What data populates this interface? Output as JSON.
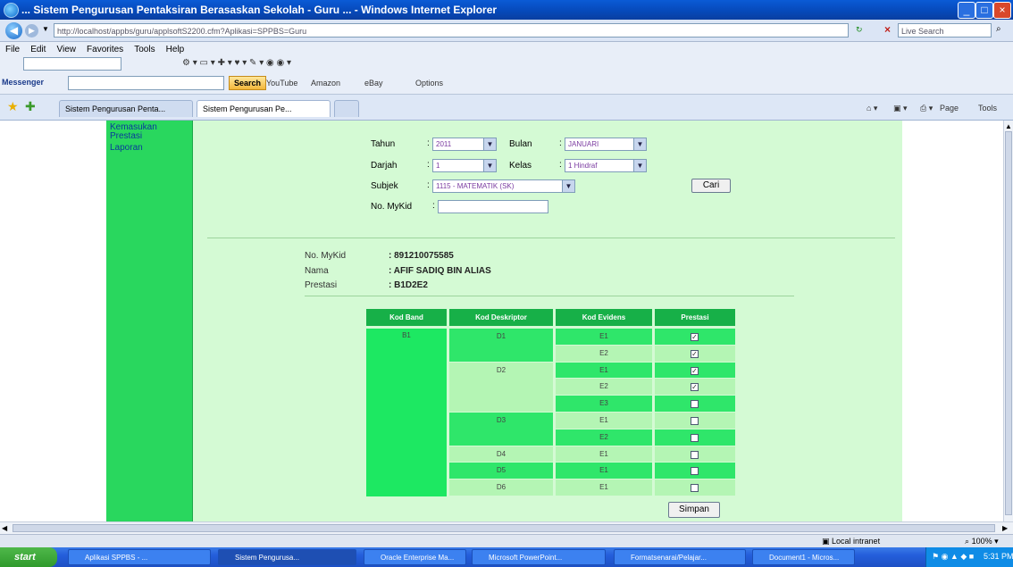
{
  "window": {
    "title": "... Sistem Pengurusan Pentaksiran Berasaskan Sekolah - Guru ... - Windows Internet Explorer"
  },
  "address": {
    "url": "http://localhost/appbs/guru/applsoftS2200.cfm?Aplikasi=SPPBS=Guru",
    "search_placeholder": "Live Search"
  },
  "menu": [
    "File",
    "Edit",
    "View",
    "Favorites",
    "Tools",
    "Help"
  ],
  "toolbar": {
    "search_label": "Search",
    "links": [
      "YouTube",
      "Amazon",
      "eBay"
    ],
    "options_label": "Options"
  },
  "tabs": [
    {
      "label": "Sistem Pengurusan Penta...",
      "active": false
    },
    {
      "label": "Sistem Pengurusan Pe...",
      "active": true
    }
  ],
  "page_tools": {
    "page_label": "Page",
    "tools_label": "Tools"
  },
  "sidebar": {
    "items": [
      "Kemasukan Prestasi",
      "Laporan"
    ]
  },
  "filters": {
    "tahun_label": "Tahun",
    "tahun_value": "2011",
    "bulan_label": "Bulan",
    "bulan_value": "JANUARI",
    "darjah_label": "Darjah",
    "darjah_value": "1",
    "kelas_label": "Kelas",
    "kelas_value": "1 Hindraf",
    "subjek_label": "Subjek",
    "subjek_value": "1115 - MATEMATIK (SK)",
    "mykid_label": "No. MyKid",
    "mykid_value": "",
    "cari_label": "Cari"
  },
  "student": {
    "mykid_label": "No. MyKid",
    "mykid_value": ": 891210075585",
    "nama_label": "Nama",
    "nama_value": ": AFIF SADIQ BIN ALIAS",
    "prestasi_label": "Prestasi",
    "prestasi_value": ": B1D2E2"
  },
  "table": {
    "headers": [
      "Kod Band",
      "Kod Deskriptor",
      "Kod Evidens",
      "Prestasi"
    ],
    "band": "B1",
    "rows": [
      {
        "deskriptor": "D1",
        "evidens": "E1",
        "checked": true
      },
      {
        "deskriptor": "",
        "evidens": "E2",
        "checked": true
      },
      {
        "deskriptor": "D2",
        "evidens": "E1",
        "checked": true
      },
      {
        "deskriptor": "",
        "evidens": "E2",
        "checked": true
      },
      {
        "deskriptor": "",
        "evidens": "E3",
        "checked": false
      },
      {
        "deskriptor": "D3",
        "evidens": "E1",
        "checked": false
      },
      {
        "deskriptor": "",
        "evidens": "E2",
        "checked": false
      },
      {
        "deskriptor": "D4",
        "evidens": "E1",
        "checked": false
      },
      {
        "deskriptor": "D5",
        "evidens": "E1",
        "checked": false
      },
      {
        "deskriptor": "D6",
        "evidens": "E1",
        "checked": false
      }
    ],
    "simpan_label": "Simpan"
  },
  "status": {
    "zone": "Local intranet",
    "zoom": "100%"
  },
  "taskbar": {
    "start_label": "start",
    "items": [
      {
        "label": "Aplikasi SPPBS - ...",
        "active": false
      },
      {
        "label": "Sistem Pengurusa...",
        "active": true
      },
      {
        "label": "Oracle Enterprise Ma...",
        "active": false
      },
      {
        "label": "Microsoft PowerPoint...",
        "active": false
      },
      {
        "label": "Formatsenarai/Pelajar...",
        "active": false
      },
      {
        "label": "Document1 - Micros...",
        "active": false
      }
    ],
    "clock": "5:31 PM"
  },
  "colors": {
    "sidebar": "#29d75e",
    "panel": "#d4fad4",
    "header": "#17b048",
    "band_col": "#1de862",
    "row_dark": "#2fe66a",
    "row_light": "#b4f5b4"
  }
}
